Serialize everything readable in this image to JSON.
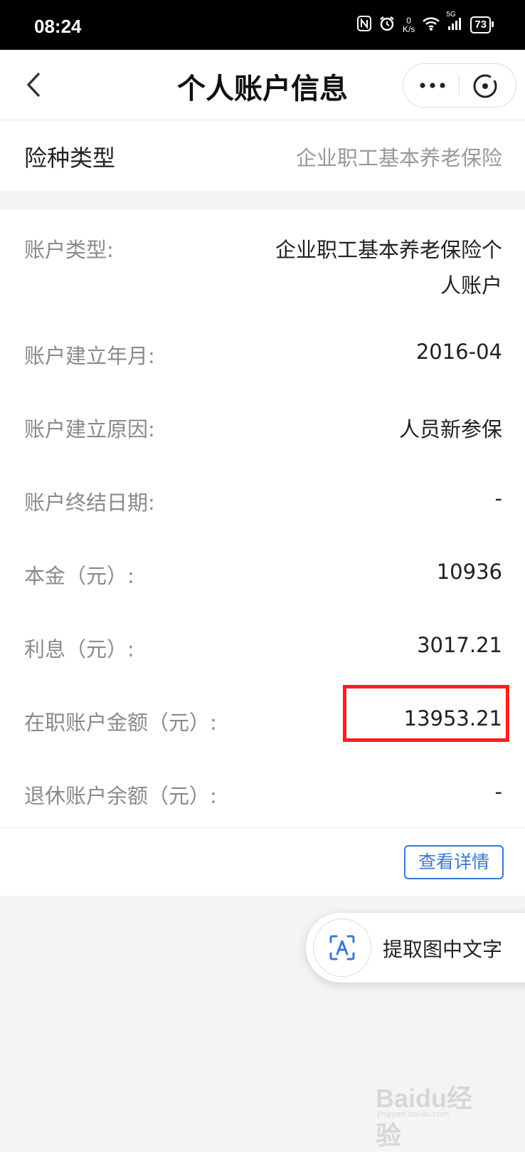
{
  "status_bar": {
    "time": "08:24",
    "speed_value": "0",
    "speed_unit": "K/s",
    "network": "5G",
    "battery": "73"
  },
  "nav": {
    "title": "个人账户信息"
  },
  "insurance_type": {
    "label": "险种类型",
    "value": "企业职工基本养老保险"
  },
  "account_info": [
    {
      "label": "账户类型:",
      "value_line1": "企业职工基本养老保险个",
      "value_line2": "人账户"
    },
    {
      "label": "账户建立年月:",
      "value": "2016-04"
    },
    {
      "label": "账户建立原因:",
      "value": "人员新参保"
    },
    {
      "label": "账户终结日期:",
      "value": "-"
    },
    {
      "label": "本金（元）:",
      "value": "10936"
    },
    {
      "label": "利息（元）:",
      "value": "3017.21"
    },
    {
      "label": "在职账户金额（元）:",
      "value": "13953.21"
    },
    {
      "label": "退休账户余额（元）:",
      "value": "-"
    }
  ],
  "details_button": "查看详情",
  "extract_button": "提取图中文字",
  "watermark": {
    "text": "Baidu经验",
    "sub": "jingyan.baidu.com"
  },
  "colors": {
    "accent_blue": "#3a78d2",
    "highlight_red": "#ff1e1e"
  }
}
